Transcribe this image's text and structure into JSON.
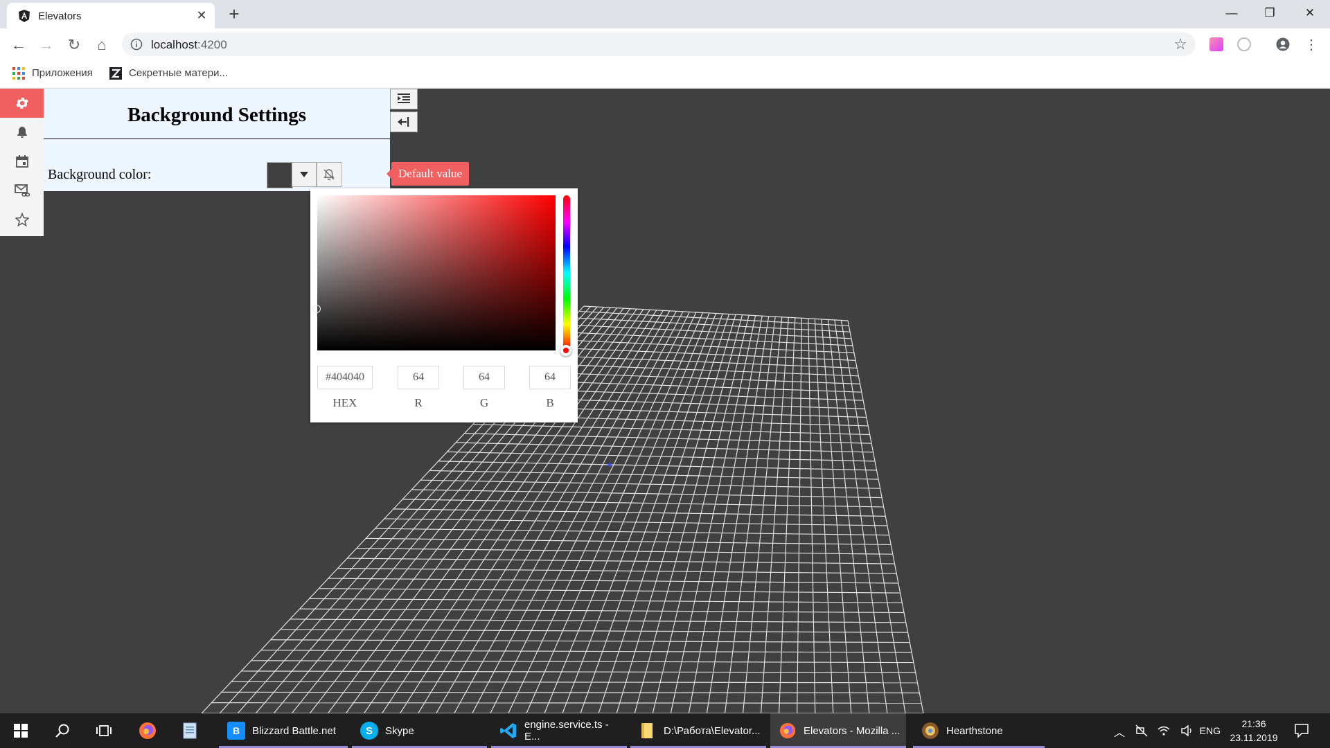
{
  "browser": {
    "tab_title": "Elevators",
    "url_host": "localhost",
    "url_port": ":4200",
    "bookmarks": [
      {
        "label": "Приложения"
      },
      {
        "label": "Секретные матери..."
      }
    ]
  },
  "sidebar": {
    "items": [
      {
        "icon": "gear-icon",
        "active": true
      },
      {
        "icon": "bell-icon",
        "active": false
      },
      {
        "icon": "calendar-icon",
        "active": false
      },
      {
        "icon": "mail-link-icon",
        "active": false
      },
      {
        "icon": "star-icon",
        "active": false
      }
    ]
  },
  "panel": {
    "title": "Background Settings",
    "background_label": "Background color:",
    "tooltip": "Default value",
    "swatch_color": "#404040"
  },
  "picker": {
    "hex_value": "#404040",
    "r_value": "64",
    "g_value": "64",
    "b_value": "64",
    "hex_label": "HEX",
    "r_label": "R",
    "g_label": "G",
    "b_label": "B",
    "hue": 0
  },
  "colors": {
    "accent": "#f06060",
    "canvas_bg": "#404040",
    "grid_line": "#ffffff"
  },
  "taskbar": {
    "apps": [
      {
        "label": "Blizzard Battle.net",
        "icon": "battlenet-icon"
      },
      {
        "label": "Skype",
        "icon": "skype-icon"
      },
      {
        "label": "engine.service.ts - E...",
        "icon": "vscode-icon"
      },
      {
        "label": "D:\\Работа\\Elevator...",
        "icon": "folder-icon"
      },
      {
        "label": "Elevators - Mozilla ...",
        "icon": "firefox-icon"
      },
      {
        "label": "Hearthstone",
        "icon": "hearthstone-icon"
      }
    ],
    "lang": "ENG",
    "time": "21:36",
    "date": "23.11.2019"
  }
}
